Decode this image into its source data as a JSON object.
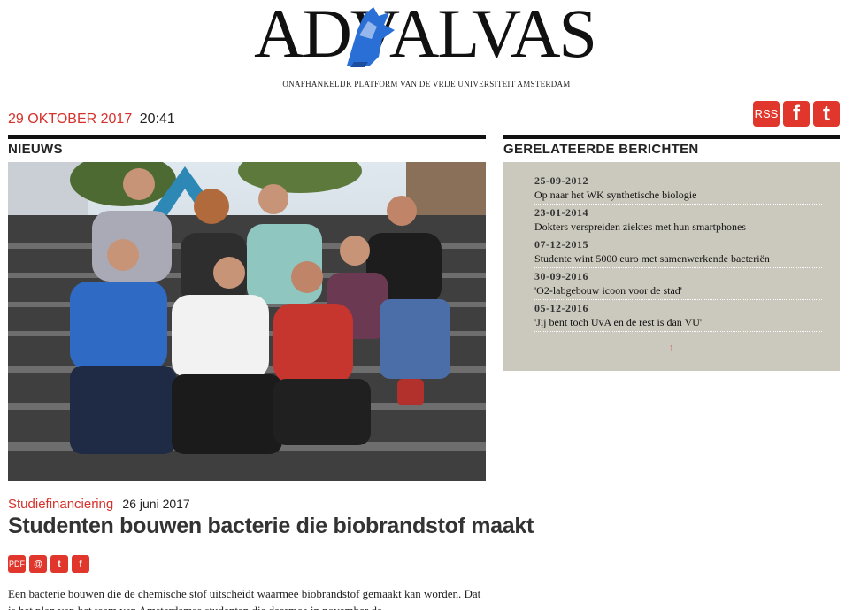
{
  "site": {
    "logo_text": "ADVALVAS",
    "tagline": "ONAFHANKELIJK PLATFORM VAN DE VRIJE UNIVERSITEIT AMSTERDAM"
  },
  "dateline": {
    "date": "29 OKTOBER 2017",
    "time": "20:41"
  },
  "social": {
    "rss": "RSS",
    "facebook": "f",
    "twitter": "t"
  },
  "left": {
    "section": "NIEUWS",
    "category": "Studiefinanciering",
    "published": "26 juni 2017",
    "headline": "Studenten bouwen bacterie die biobrandstof maakt",
    "share": {
      "pdf": "PDF",
      "email": "@",
      "twitter": "t",
      "facebook": "f"
    },
    "body": "Een bacterie bouwen die de chemische stof uitscheidt waarmee biobrandstof gemaakt kan worden. Dat is het plan van het team van Amsterdamse studenten die daarmee in november de"
  },
  "right": {
    "section": "GERELATEERDE BERICHTEN",
    "items": [
      {
        "date": "25-09-2012",
        "title": "Op naar het WK synthetische biologie"
      },
      {
        "date": "23-01-2014",
        "title": "Dokters verspreiden ziektes met hun smartphones"
      },
      {
        "date": "07-12-2015",
        "title": "Studente wint 5000 euro met samenwerkende bacteriën"
      },
      {
        "date": "30-09-2016",
        "title": "'O2-labgebouw icoon voor de stad'"
      },
      {
        "date": "05-12-2016",
        "title": "'Jij bent toch UvA en de rest is dan VU'"
      }
    ],
    "page": "1"
  },
  "colors": {
    "accent": "#d6312b",
    "related_bg": "#cbc9bd",
    "logo_blue": "#2a6fd6"
  }
}
